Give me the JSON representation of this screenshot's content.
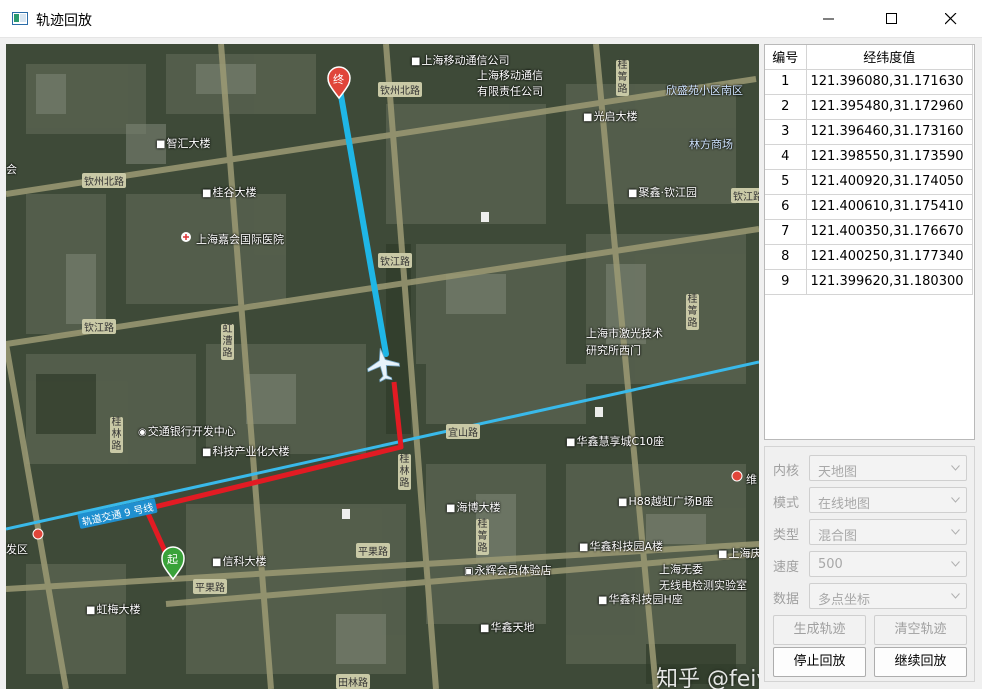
{
  "window": {
    "title": "轨迹回放",
    "controls": [
      "minimize",
      "maximize",
      "close"
    ]
  },
  "map": {
    "labels": {
      "l1": "上海移动通信公司",
      "l2": "上海移动通信",
      "l3": "有限责任公司",
      "l4": "欣盛苑小区南区",
      "l5": "光启大楼",
      "l6": "智汇大楼",
      "l7": "桂谷大楼",
      "l8": "上海嘉会国际医院",
      "l9": "聚鑫·钦江园",
      "l10": "上海市激光技术",
      "l11": "研究所西门",
      "l12": "交通银行开发中心",
      "l13": "科技产业化大楼",
      "l14": "华鑫慧享城C10座",
      "l15": "海博大楼",
      "l16": "H88越虹广场B座",
      "l17": "华鑫科技园A楼",
      "l18": "上海庆",
      "l19": "永辉会员体验店",
      "l20": "上海无委",
      "l21": "无线电检测实验室",
      "l22": "华鑫科技园H座",
      "l23": "华鑫天地",
      "l24": "信科大楼",
      "l25": "虹梅大楼",
      "l26": "会",
      "l27": "发区",
      "l28": "维",
      "l29": "林方商场",
      "road1": "钦州北路",
      "road2": "钦州北路",
      "road3": "钦江路",
      "road4": "钦江路",
      "road5": "钦江路",
      "road6": "宜山路",
      "road7": "平果路",
      "road8": "平果路",
      "road9": "田林路",
      "road10": "虹漕路",
      "road11": "桂林路",
      "road12": "桂箐路",
      "road13": "桂林路",
      "road14": "桂箐路",
      "road15": "桂箐路",
      "metro": "轨道交通 9 号线",
      "start_marker": "起",
      "end_marker": "终"
    },
    "watermark": "知乎 @feiyangqingyun"
  },
  "table": {
    "headers": [
      "编号",
      "经纬度值"
    ],
    "rows": [
      {
        "idx": "1",
        "value": "121.396080,31.171630"
      },
      {
        "idx": "2",
        "value": "121.395480,31.172960"
      },
      {
        "idx": "3",
        "value": "121.396460,31.173160"
      },
      {
        "idx": "4",
        "value": "121.398550,31.173590"
      },
      {
        "idx": "5",
        "value": "121.400920,31.174050"
      },
      {
        "idx": "6",
        "value": "121.400610,31.175410"
      },
      {
        "idx": "7",
        "value": "121.400350,31.176670"
      },
      {
        "idx": "8",
        "value": "121.400250,31.177340"
      },
      {
        "idx": "9",
        "value": "121.399620,31.180300"
      }
    ]
  },
  "controls": {
    "kernel": {
      "label": "内核",
      "value": "天地图"
    },
    "mode": {
      "label": "模式",
      "value": "在线地图"
    },
    "type": {
      "label": "类型",
      "value": "混合图"
    },
    "speed": {
      "label": "速度",
      "value": "500"
    },
    "data": {
      "label": "数据",
      "value": "多点坐标"
    },
    "buttons": {
      "generate": "生成轨迹",
      "clear": "清空轨迹",
      "stop": "停止回放",
      "resume": "继续回放"
    }
  },
  "colors": {
    "played_track": "#e21b23",
    "remaining_track": "#1fb6e6",
    "start_marker": "#3aa23a",
    "end_marker": "#e0453a",
    "metro_line": "#33b7e8"
  }
}
